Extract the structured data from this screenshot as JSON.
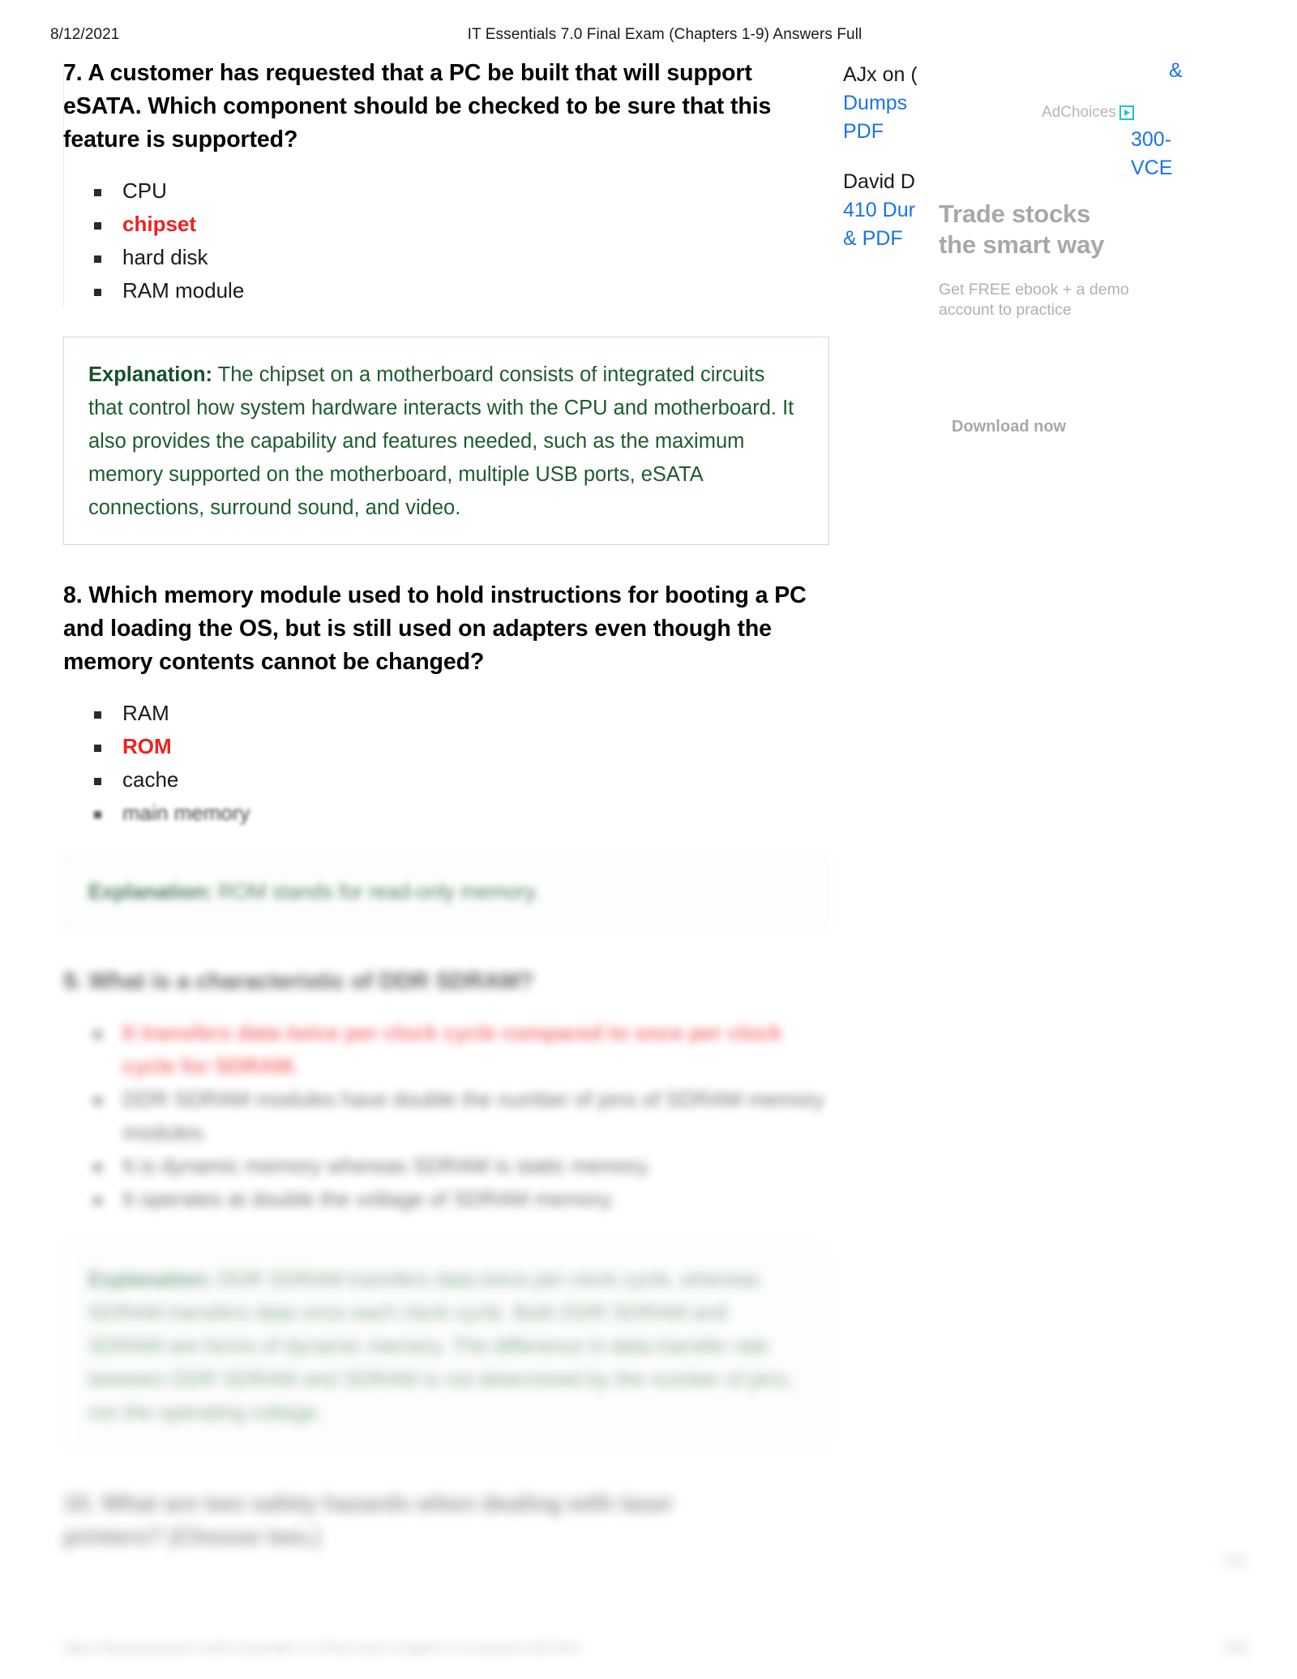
{
  "print_header": {
    "date": "8/12/2021",
    "title": "IT Essentials 7.0 Final Exam (Chapters 1-9) Answers Full"
  },
  "questions": [
    {
      "number": "7.",
      "text": "7. A customer has requested that a PC be built that will support eSATA. Which component should be checked to be sure that this feature is supported?",
      "options": [
        {
          "label": "CPU",
          "correct": false
        },
        {
          "label": "chipset",
          "correct": true
        },
        {
          "label": "hard disk",
          "correct": false
        },
        {
          "label": "RAM module",
          "correct": false
        }
      ],
      "explanation_lead": "Explanation:",
      "explanation_body": " The chipset on a motherboard consists of integrated circuits that control how system hardware interacts with the CPU and motherboard. It also provides the capability and features needed, such as the maximum memory supported on the motherboard, multiple USB ports, eSATA connections, surround sound, and video."
    },
    {
      "number": "8.",
      "text": "8. Which memory module used to hold instructions for booting a PC and loading the OS, but is still used on adapters even though the memory contents cannot be changed?",
      "options": [
        {
          "label": "RAM",
          "correct": false
        },
        {
          "label": "ROM",
          "correct": true
        },
        {
          "label": "cache",
          "correct": false
        },
        {
          "label": "main memory",
          "correct": false
        }
      ],
      "explanation_lead": "Explanation:",
      "explanation_body": " ROM stands for read-only memory."
    },
    {
      "number": "9.",
      "text": "9. What is a characteristic of DDR SDRAM?",
      "options": [
        {
          "label": "It transfers data twice per clock cycle compared to once per clock cycle for SDRAM.",
          "correct": true
        },
        {
          "label": "DDR SDRAM modules have double the number of pins of SDRAM memory modules.",
          "correct": false
        },
        {
          "label": "It is dynamic memory whereas SDRAM is static memory.",
          "correct": false
        },
        {
          "label": "It operates at double the voltage of SDRAM memory.",
          "correct": false
        }
      ],
      "explanation_lead": "Explanation:",
      "explanation_body": " DDR SDRAM transfers data twice per clock cycle, whereas SDRAM transfers data once each clock cycle. Both DDR SDRAM and SDRAM are forms of dynamic memory. The difference in data transfer rate between DDR SDRAM and SDRAM is not determined by the number of pins, nor the operating voltage."
    },
    {
      "number": "10.",
      "text": "10. What are two safety hazards when dealing with laser printers? (Choose two.)"
    }
  ],
  "ads": {
    "adchoices_label": "AdChoices",
    "links": [
      {
        "dark": "AJx on (",
        "blue": [
          "Dumps",
          "PDF"
        ]
      },
      {
        "dark": "David D",
        "blue": [
          "410 Dur",
          "& PDF"
        ]
      }
    ],
    "right_column": {
      "amp": "&",
      "cert": [
        "300-",
        "VCE"
      ]
    },
    "creative": {
      "headline_line1": "Trade stocks",
      "headline_line2": "the smart way",
      "subtext": "Get FREE ebook + a demo account to practice",
      "cta": "Download now"
    }
  },
  "footer": {
    "left": "https://itexamanswers.net/it-essentials-7-0-final-exam-chapters-1-9-answers-full.html",
    "right": "7/69",
    "side_mark": "ITE"
  },
  "colors": {
    "answer_red": "#ef2121",
    "explanation_green": "#1d5c2e",
    "link_blue": "#1a73e8",
    "ad_gray": "#a8a8a8",
    "box_border": "#cddccd"
  }
}
